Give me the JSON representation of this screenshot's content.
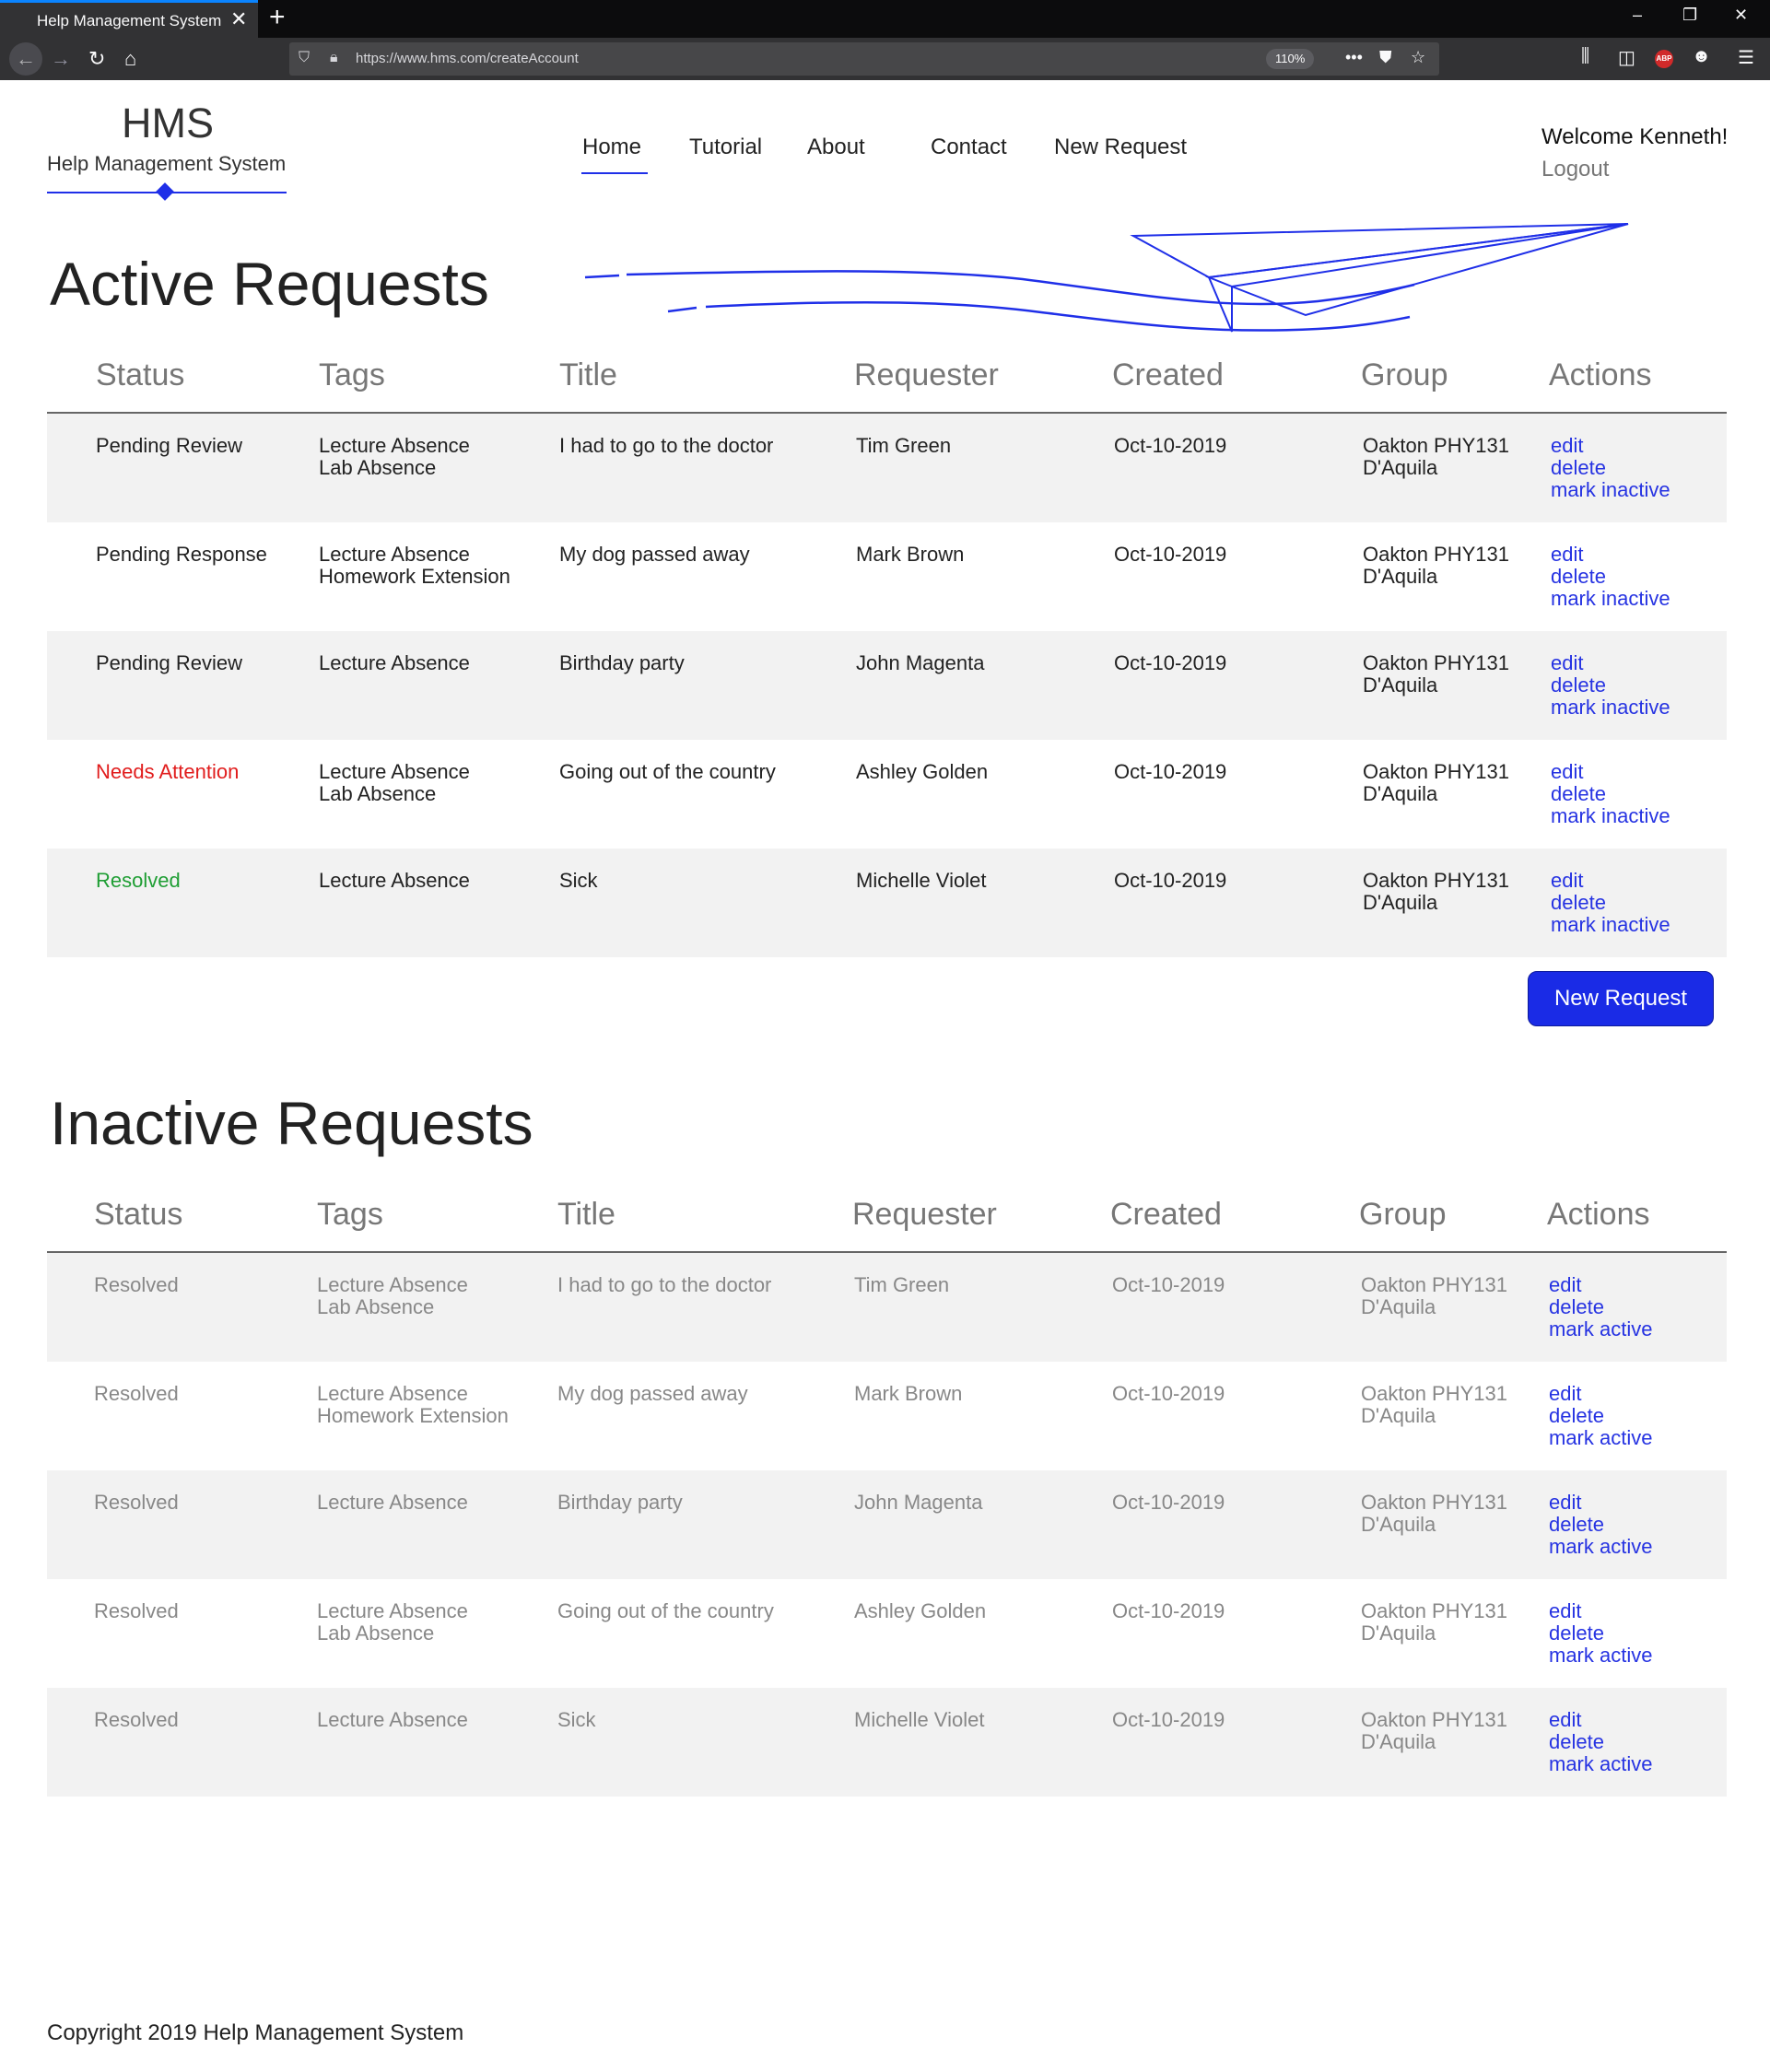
{
  "browser": {
    "tab_title": "Help Management System",
    "tab_close": "✕",
    "new_tab": "+",
    "url": "https://www.hms.com/createAccount",
    "zoom": "110%",
    "window_minimize": "–",
    "window_restore": "❐",
    "window_close": "✕"
  },
  "header": {
    "logo_title": "HMS",
    "logo_subtitle": "Help Management System",
    "nav": [
      "Home",
      "Tutorial",
      "About",
      "Contact",
      "New Request"
    ],
    "active_nav": "Home",
    "welcome": "Welcome Kenneth!",
    "logout": "Logout",
    "accent_color": "#1f2fe8"
  },
  "columns": [
    "Status",
    "Tags",
    "Title",
    "Requester",
    "Created",
    "Group",
    "Actions"
  ],
  "active": {
    "title": "Active Requests",
    "rows": [
      {
        "status": "Pending Review",
        "tags": [
          "Lecture Absence",
          "Lab Absence"
        ],
        "title": "I had to go to the doctor",
        "requester": "Tim Green",
        "created": "Oct-10-2019",
        "group": [
          "Oakton PHY131",
          "D'Aquila"
        ]
      },
      {
        "status": "Pending Response",
        "tags": [
          "Lecture Absence",
          "Homework Extension"
        ],
        "title": "My dog passed away",
        "requester": "Mark Brown",
        "created": "Oct-10-2019",
        "group": [
          "Oakton PHY131",
          "D'Aquila"
        ]
      },
      {
        "status": "Pending Review",
        "tags": [
          "Lecture Absence"
        ],
        "title": "Birthday party",
        "requester": "John Magenta",
        "created": "Oct-10-2019",
        "group": [
          "Oakton PHY131",
          "D'Aquila"
        ]
      },
      {
        "status": "Needs Attention",
        "tags": [
          "Lecture Absence",
          "Lab Absence"
        ],
        "title": "Going out of the country",
        "requester": "Ashley Golden",
        "created": "Oct-10-2019",
        "group": [
          "Oakton PHY131",
          "D'Aquila"
        ]
      },
      {
        "status": "Resolved",
        "tags": [
          "Lecture Absence"
        ],
        "title": "Sick",
        "requester": "Michelle Violet",
        "created": "Oct-10-2019",
        "group": [
          "Oakton PHY131",
          "D'Aquila"
        ]
      }
    ],
    "actions": [
      "edit",
      "delete",
      "mark inactive"
    ],
    "new_request_button": "New Request"
  },
  "inactive": {
    "title": "Inactive Requests",
    "rows": [
      {
        "status": "Resolved",
        "tags": [
          "Lecture Absence",
          "Lab Absence"
        ],
        "title": "I had to go to the doctor",
        "requester": "Tim Green",
        "created": "Oct-10-2019",
        "group": [
          "Oakton PHY131",
          "D'Aquila"
        ]
      },
      {
        "status": "Resolved",
        "tags": [
          "Lecture Absence",
          "Homework Extension"
        ],
        "title": "My dog passed away",
        "requester": "Mark Brown",
        "created": "Oct-10-2019",
        "group": [
          "Oakton PHY131",
          "D'Aquila"
        ]
      },
      {
        "status": "Resolved",
        "tags": [
          "Lecture Absence"
        ],
        "title": "Birthday party",
        "requester": "John Magenta",
        "created": "Oct-10-2019",
        "group": [
          "Oakton PHY131",
          "D'Aquila"
        ]
      },
      {
        "status": "Resolved",
        "tags": [
          "Lecture Absence",
          "Lab Absence"
        ],
        "title": "Going out of the country",
        "requester": "Ashley Golden",
        "created": "Oct-10-2019",
        "group": [
          "Oakton PHY131",
          "D'Aquila"
        ]
      },
      {
        "status": "Resolved",
        "tags": [
          "Lecture Absence"
        ],
        "title": "Sick",
        "requester": "Michelle Violet",
        "created": "Oct-10-2019",
        "group": [
          "Oakton PHY131",
          "D'Aquila"
        ]
      }
    ],
    "actions": [
      "edit",
      "delete",
      "mark active"
    ]
  },
  "status_colors": {
    "Needs Attention": "#e11d1d",
    "Resolved": "#1f9e34"
  },
  "footer": "Copyright 2019 Help Management System"
}
